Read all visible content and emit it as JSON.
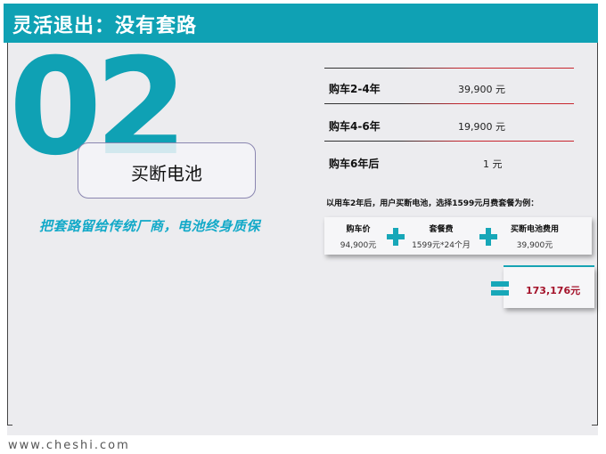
{
  "header": {
    "title": "灵活退出：没有套路"
  },
  "section": {
    "number": "02",
    "method": "买断电池"
  },
  "slogan": "把套路留给传统厂商，电池终身质保",
  "price_table": [
    {
      "label": "购车2-4年",
      "value": "39,900 元"
    },
    {
      "label": "购车4-6年",
      "value": "19,900 元"
    },
    {
      "label": "购车6年后",
      "value": "1 元"
    }
  ],
  "example": {
    "note": "以用车2年后，用户买断电池，选择1599元月费套餐为例：",
    "items": [
      {
        "title": "购车价",
        "value": "94,900元"
      },
      {
        "title": "套餐费",
        "value": "1599元*24个月"
      },
      {
        "title": "买断电池费用",
        "value": "39,900元"
      }
    ],
    "total": "173,176元"
  },
  "colors": {
    "accent": "#0fa1b4",
    "result": "#a4122a",
    "slogan": "#12a9c8"
  },
  "watermark": "www.cheshi.com"
}
